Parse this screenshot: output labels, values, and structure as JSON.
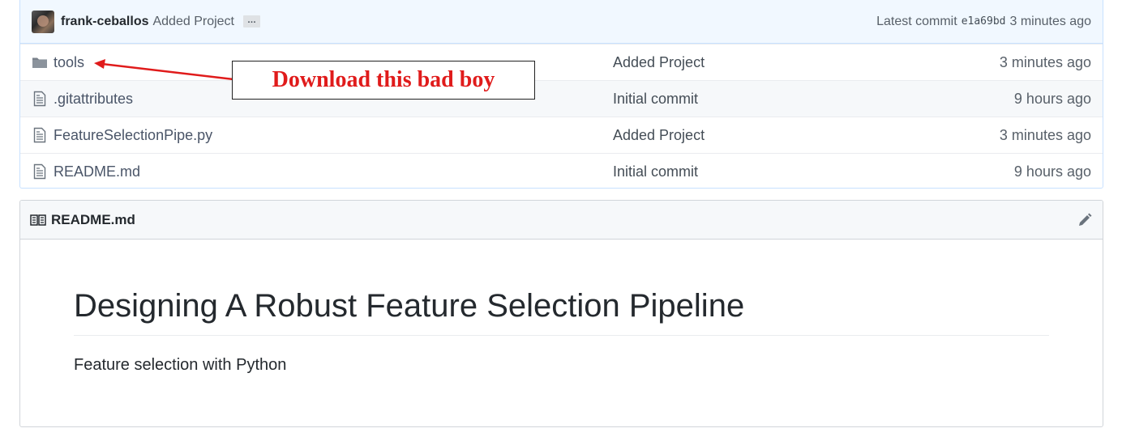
{
  "commit": {
    "author": "frank-ceballos",
    "message": "Added Project",
    "ellipsis": "…",
    "latest_label": "Latest commit",
    "sha": "e1a69bd",
    "age": "3 minutes ago"
  },
  "files": [
    {
      "name": "tools",
      "icon": "folder-icon",
      "message": "Added Project",
      "age": "3 minutes ago"
    },
    {
      "name": ".gitattributes",
      "icon": "file-icon",
      "message": "Initial commit",
      "age": "9 hours ago"
    },
    {
      "name": "FeatureSelectionPipe.py",
      "icon": "file-icon",
      "message": "Added Project",
      "age": "3 minutes ago"
    },
    {
      "name": "README.md",
      "icon": "file-icon",
      "message": "Initial commit",
      "age": "9 hours ago"
    }
  ],
  "annotation": {
    "text": "Download this bad boy",
    "color": "#e01b1b"
  },
  "readme": {
    "filename": "README.md",
    "title": "Designing A Robust Feature Selection Pipeline",
    "description": "Feature selection with Python"
  }
}
